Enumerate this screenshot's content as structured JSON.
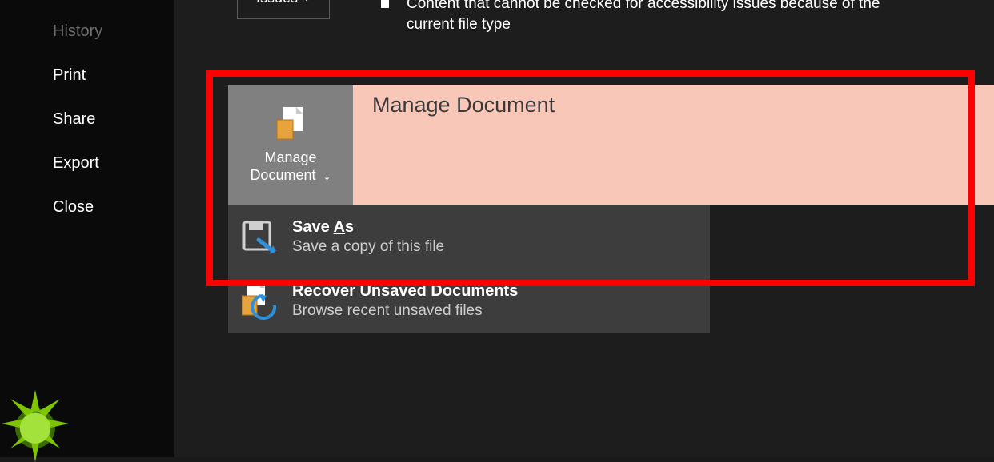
{
  "sidebar": {
    "items": [
      {
        "label": "History",
        "disabled": true
      },
      {
        "label": "Print",
        "disabled": false
      },
      {
        "label": "Share",
        "disabled": false
      },
      {
        "label": "Export",
        "disabled": false
      },
      {
        "label": "Close",
        "disabled": false
      }
    ]
  },
  "issues_button": {
    "label": "Issues"
  },
  "note_text": "Content that cannot be checked for accessibility issues because of the current file type",
  "manage": {
    "title": "Manage Document",
    "button_line1": "Manage",
    "button_line2": "Document"
  },
  "menu": {
    "save_as": {
      "title_pre": "Save ",
      "title_ul": "A",
      "title_post": "s",
      "desc": "Save a copy of this file"
    },
    "recover": {
      "title": "Recover Unsaved Documents",
      "desc": "Browse recent unsaved files"
    }
  }
}
